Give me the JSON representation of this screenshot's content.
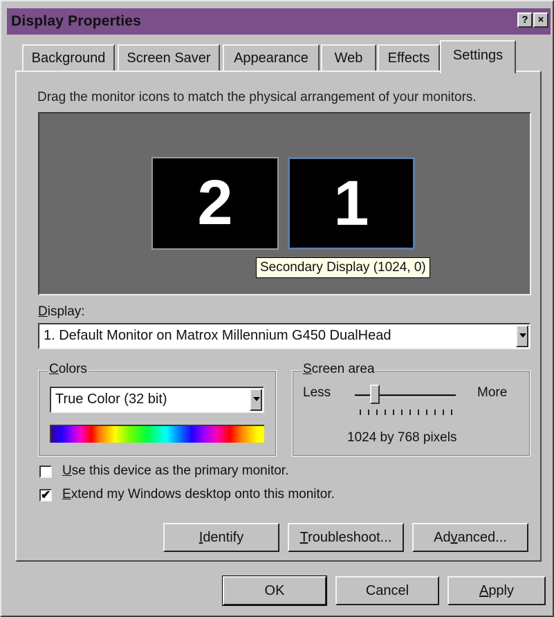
{
  "window": {
    "title": "Display Properties",
    "help_btn": "?",
    "close_btn": "×"
  },
  "tabs": [
    {
      "label": "Background"
    },
    {
      "label": "Screen Saver"
    },
    {
      "label": "Appearance"
    },
    {
      "label": "Web"
    },
    {
      "label": "Effects"
    },
    {
      "label": "Settings"
    }
  ],
  "settings": {
    "instruction": "Drag the monitor icons to match the physical arrangement of your monitors.",
    "monitors": [
      {
        "number": "2"
      },
      {
        "number": "1"
      }
    ],
    "tooltip": "Secondary Display (1024, 0)",
    "display_label_u": "D",
    "display_label_rest": "isplay:",
    "display_value": "1. Default Monitor on Matrox Millennium G450 DualHead",
    "colors_label_u": "C",
    "colors_label_rest": "olors",
    "colors_value": "True Color (32 bit)",
    "screen_area_label_u": "S",
    "screen_area_label_rest": "creen area",
    "slider_less": "Less",
    "slider_more": "More",
    "resolution_text": "1024 by 768 pixels",
    "resolution_slider_position": 0.2,
    "primary_check_u": "U",
    "primary_check_rest": "se this device as the primary monitor.",
    "primary_checked": false,
    "extend_check_u": "E",
    "extend_check_rest": "xtend my Windows desktop onto this monitor.",
    "extend_checked": true,
    "extend_mark": "✔",
    "identify_u": "I",
    "identify_rest": "dentify",
    "troubleshoot_u": "T",
    "troubleshoot_rest": "roubleshoot...",
    "advanced_a": "Ad",
    "advanced_u": "v",
    "advanced_rest": "anced..."
  },
  "footer": {
    "ok": "OK",
    "cancel": "Cancel",
    "apply_u": "A",
    "apply_rest": "pply"
  },
  "colors": {
    "titlebar": "#7a4f8a",
    "dialog": "#c2c2c2",
    "preview_bg": "#6a6a6a",
    "monitor_selected_border": "#5a7fa8"
  }
}
